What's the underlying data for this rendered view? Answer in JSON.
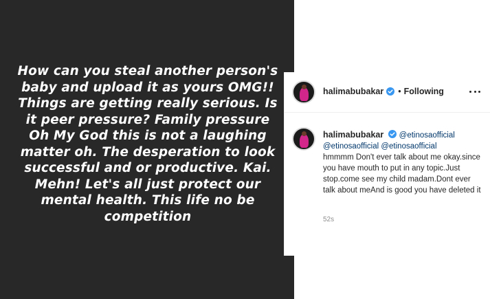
{
  "story": {
    "text": "How can you steal another person's\nbaby and upload it as yours OMG!!\nThings are getting really serious. Is\nit peer pressure? Family pressure\nOh My God this is not a laughing\nmatter oh. The desperation to look\nsuccessful and or productive. Kai.\nMehn! Let's all just protect our\nmental health. This life no be\ncompetition",
    "background": "#282828"
  },
  "post": {
    "header": {
      "username": "halimabubakar",
      "separator": "•",
      "follow_status": "Following"
    },
    "comment": {
      "username": "halimabubakar",
      "mentions": [
        "@etinosaofficial",
        "@etinosaofficial",
        "@etinosaofficial"
      ],
      "text": "hmmmm Don't ever talk about me okay.since you have mouth to put in any topic.Just stop.come see my child madam.Dont ever talk about meAnd is good you have deleted it",
      "time": "52s"
    },
    "verified_color": "#3897f0",
    "mention_color": "#00376b"
  }
}
